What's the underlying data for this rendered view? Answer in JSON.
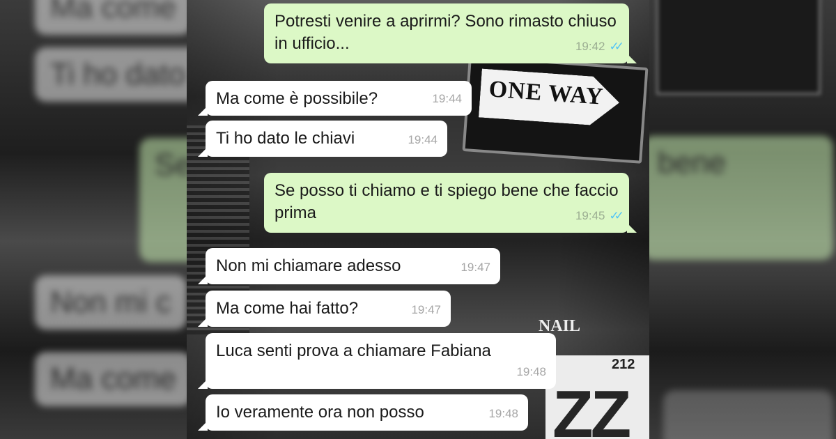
{
  "messages": [
    {
      "direction": "out",
      "text": "Potresti venire a aprirmi? Sono rimasto chiuso in ufficio...",
      "time": "19:42",
      "status": "read"
    },
    {
      "direction": "in",
      "text": "Ma come è possibile?",
      "time": "19:44"
    },
    {
      "direction": "in",
      "text": "Ti ho dato le chiavi",
      "time": "19:44"
    },
    {
      "direction": "out",
      "text": "Se posso ti chiamo e ti spiego bene che faccio prima",
      "time": "19:45",
      "status": "read"
    },
    {
      "direction": "in",
      "text": "Non mi chiamare adesso",
      "time": "19:47"
    },
    {
      "direction": "in",
      "text": "Ma come hai fatto?",
      "time": "19:47"
    },
    {
      "direction": "in",
      "text": "Luca senti prova a chiamare Fabiana",
      "time": "19:48"
    },
    {
      "direction": "in",
      "text": "Io veramente ora non posso",
      "time": "19:48"
    }
  ],
  "background": {
    "sign_text": "ONE WAY",
    "nail_text": "NAIL",
    "building_number": "212",
    "letters": "ZZ"
  },
  "colors": {
    "incoming_bubble": "#ffffff",
    "outgoing_bubble": "#dcf8c6",
    "read_ticks": "#4fc3f7",
    "timestamp": "#a6a6a6"
  },
  "icons": {
    "read_receipt": "double-check-icon"
  }
}
